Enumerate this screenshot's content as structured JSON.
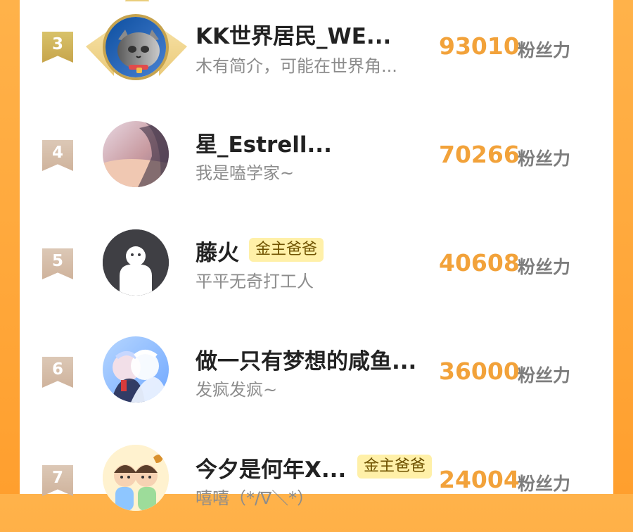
{
  "list": [
    {
      "rank": "3",
      "name": "KK世界居民_WE...",
      "bio": "木有简介，可能在世界角...",
      "badge": "",
      "score": "93010",
      "score_label": "粉丝力",
      "icon": "crowned-cat-avatar"
    },
    {
      "rank": "4",
      "name": "星_Estrell...",
      "bio": "我是嗑学家~",
      "badge": "",
      "score": "70266",
      "score_label": "粉丝力",
      "icon": "anime-portrait-avatar"
    },
    {
      "rank": "5",
      "name": "藤火",
      "bio": "平平无奇打工人",
      "badge": "金主爸爸",
      "score": "40608",
      "score_label": "粉丝力",
      "icon": "default-ghost-avatar"
    },
    {
      "rank": "6",
      "name": "做一只有梦想的咸鱼...",
      "bio": "发疯发疯~",
      "badge": "",
      "score": "36000",
      "score_label": "粉丝力",
      "icon": "anime-couple-avatar"
    },
    {
      "rank": "7",
      "name": "今夕是何年X...",
      "bio": "嘻嘻（*/∇＼*）",
      "badge": "金主爸爸",
      "score": "24004",
      "score_label": "粉丝力",
      "icon": "cartoon-boys-avatar"
    }
  ],
  "colors": {
    "background": "#ff9f2e",
    "score": "#f2a23a",
    "gold_rank": "#c7a54c",
    "beige_rank": "#cfb39c",
    "badge_bg": "#fff0a8",
    "badge_text": "#6f5200"
  }
}
